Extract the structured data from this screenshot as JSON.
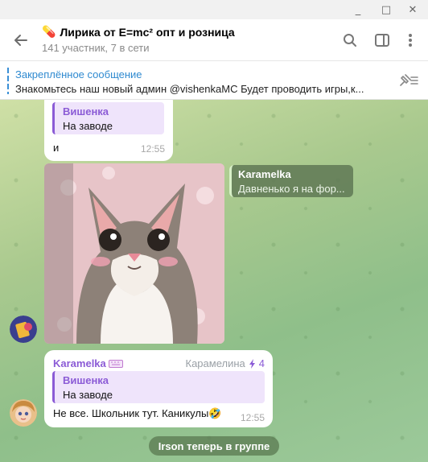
{
  "window": {
    "minimize": "_",
    "maximize": "□",
    "close": "✕"
  },
  "header": {
    "title": "Лирика от E=mc² опт и розница",
    "subtitle": "141 участник, 7 в сети",
    "title_emoji": "💊"
  },
  "pinned": {
    "title": "Закреплённое сообщение",
    "text": "Знакомьтесь наш новый админ @vishenkaMC Будет проводить игры,к..."
  },
  "messages": [
    {
      "quote": {
        "name": "Вишенка",
        "text": "На заводе"
      },
      "text": "и",
      "time": "12:55"
    },
    {
      "reply": {
        "name": "Karamelka",
        "text": "Давненько я на фор..."
      }
    },
    {
      "sender": "Karamelka",
      "rank_title": "Карамелина",
      "rank_value": "4",
      "quote": {
        "name": "Вишенка",
        "text": "На заводе"
      },
      "text": "Не все. Школьник тут. Каникулы",
      "emoji": "🤣",
      "time": "12:55"
    }
  ],
  "service": {
    "text": "Irson теперь в группе"
  },
  "colors": {
    "accent": "#2f8ad0",
    "quote": "#8b5bd6",
    "chat_bg": "#a9c98e"
  }
}
